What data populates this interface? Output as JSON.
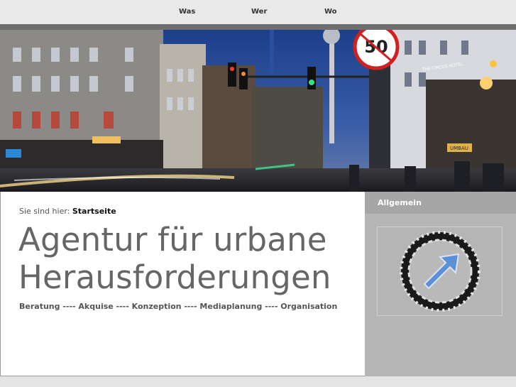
{
  "nav": {
    "items": [
      "Was",
      "Wer",
      "Wo"
    ]
  },
  "breadcrumb": {
    "prefix": "Sie sind hier:",
    "current": "Startseite"
  },
  "headline": {
    "line1": "Agentur für urbane",
    "line2": "Herausforderungen"
  },
  "services": "Beratung ---- Akquise ---- Konzeption ---- Mediaplanung ---- Organisation",
  "sidebar": {
    "title": "Allgemein"
  },
  "hero": {
    "sign_speed": "50",
    "hotel_sign": "THE CIRCUS HOTEL",
    "umbau_sign": "UMBAU"
  },
  "colors": {
    "accent_blue": "#5b8fd6",
    "sidebar": "#b5b5b5",
    "headline": "#666666"
  },
  "icons": [
    "arrow-logo-icon"
  ]
}
